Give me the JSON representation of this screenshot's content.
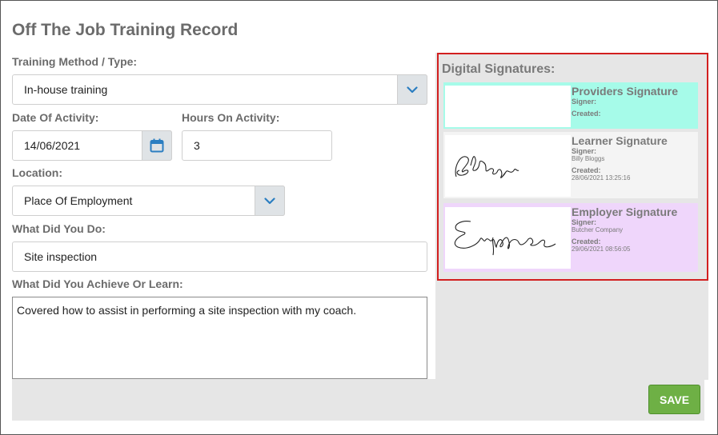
{
  "form": {
    "title": "Off The Job Training Record",
    "training_method_label": "Training Method / Type:",
    "training_method_value": "In-house training",
    "date_label": "Date Of Activity:",
    "date_value": "14/06/2021",
    "hours_label": "Hours On Activity:",
    "hours_value": "3",
    "location_label": "Location:",
    "location_value": "Place Of Employment",
    "what_did_label": "What Did You Do:",
    "what_did_value": "Site inspection",
    "achieve_label": "What Did You Achieve Or Learn:",
    "achieve_value": "Covered how to assist in performing a site inspection with my coach.",
    "save_label": "SAVE"
  },
  "signatures": {
    "heading": "Digital Signatures:",
    "items": [
      {
        "title": "Providers Signature",
        "signer_label": "Signer:",
        "signer": "",
        "created_label": "Created:",
        "created": "",
        "color": "#a6fbe9"
      },
      {
        "title": "Learner Signature",
        "signer_label": "Signer:",
        "signer": "Billy Bloggs",
        "created_label": "Created:",
        "created": "28/06/2021 13:25:16",
        "color": "#f4f4f4"
      },
      {
        "title": "Employer Signature",
        "signer_label": "Signer:",
        "signer": "Butcher Company",
        "created_label": "Created:",
        "created": "29/06/2021 08:56:05",
        "color": "#efd6fb"
      }
    ]
  },
  "colors": {
    "accent": "#2b7ec1",
    "save": "#6eb045",
    "highlight": "#d21f1f"
  }
}
